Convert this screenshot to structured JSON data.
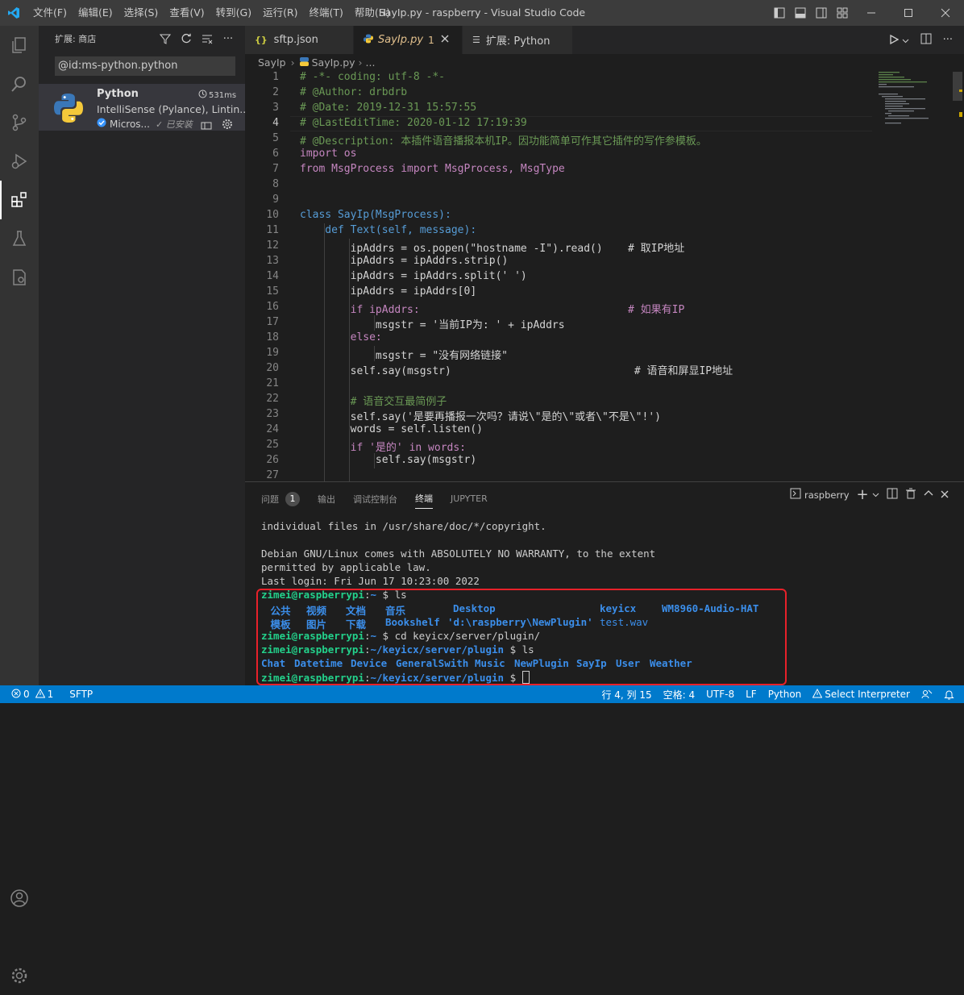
{
  "titlebar": {
    "menu": [
      "文件(F)",
      "编辑(E)",
      "选择(S)",
      "查看(V)",
      "转到(G)",
      "运行(R)",
      "终端(T)",
      "帮助(H)"
    ],
    "title": "SayIp.py - raspberry - Visual Studio Code"
  },
  "sidebar": {
    "title": "扩展: 商店",
    "search_value": "@id:ms-python.python",
    "extension": {
      "name": "Python",
      "timing": "531ms",
      "description": "IntelliSense (Pylance), Lintin...",
      "publisher": "Micros...",
      "status": "✓ 已安装"
    }
  },
  "tabs": [
    {
      "label": "sftp.json",
      "icon": "braces-icon"
    },
    {
      "label": "SayIp.py",
      "badge": "1",
      "icon": "python-file-icon"
    },
    {
      "label": "扩展: Python",
      "icon": "extension-icon"
    }
  ],
  "breadcrumb": {
    "folder": "SayIp",
    "file": "SayIp.py",
    "more": "..."
  },
  "editor": {
    "line_numbers": [
      "1",
      "2",
      "3",
      "4",
      "5",
      "6",
      "7",
      "8",
      "9",
      "10",
      "11",
      "12",
      "13",
      "14",
      "15",
      "16",
      "17",
      "18",
      "19",
      "20",
      "21",
      "22",
      "23",
      "24",
      "25",
      "26",
      "27"
    ],
    "lines": [
      "# -*- coding: utf-8 -*-",
      "# @Author: drbdrb",
      "# @Date: 2019-12-31 15:57:55",
      "# @LastEditTime: 2020-01-12 17:19:39",
      "# @Description: 本插件语音播报本机IP。因功能简单可作其它插件的写作参模板。",
      "import os",
      "from MsgProcess import MsgProcess, MsgType",
      "",
      "",
      "class SayIp(MsgProcess):",
      "    def Text(self, message):",
      "        ipAddrs = os.popen(\"hostname -I\").read()    # 取IP地址",
      "        ipAddrs = ipAddrs.strip()",
      "        ipAddrs = ipAddrs.split(' ')",
      "        ipAddrs = ipAddrs[0]",
      "        if ipAddrs:                                 # 如果有IP",
      "            msgstr = '当前IP为: ' + ipAddrs",
      "        else:",
      "            msgstr = \"没有网络链接\"",
      "        self.say(msgstr)                             # 语音和屏显IP地址",
      "",
      "        # 语音交互最简例子",
      "        self.say('是要再播报一次吗？请说\\\"是的\\\"或者\\\"不是\\\"!')",
      "        words = self.listen()",
      "        if '是的' in words:",
      "            self.say(msgstr)",
      ""
    ]
  },
  "panel": {
    "tabs": [
      "问题",
      "输出",
      "调试控制台",
      "终端",
      "JUPYTER"
    ],
    "problems_count": "1",
    "terminal_name": "raspberry",
    "terminal_lines": [
      "individual files in /usr/share/doc/*/copyright.",
      "",
      "Debian GNU/Linux comes with ABSOLUTELY NO WARRANTY, to the extent",
      "permitted by applicable law.",
      "Last login: Fri Jun 17 10:23:00 2022"
    ],
    "prompt_user": "zimei@raspberrypi",
    "cmd1": "ls",
    "ls1_row1": [
      " 公共",
      "视频",
      "文档",
      "音乐",
      "Desktop",
      "keyicx",
      "WM8960-Audio-HAT"
    ],
    "ls1_row2": [
      " 模板",
      "图片",
      "下载",
      "Bookshelf",
      "'d:\\raspberry\\NewPlugin'",
      "test.wav"
    ],
    "cmd2": "cd keyicx/server/plugin/",
    "path3": "~/keyicx/server/plugin",
    "cmd3": "ls",
    "ls2": [
      "Chat",
      "Datetime",
      "Device",
      "GeneralSwith",
      "Music",
      "NewPlugin",
      "SayIp",
      "User",
      "Weather"
    ]
  },
  "statusbar": {
    "errors": "0",
    "warnings": "1",
    "sftp": "SFTP",
    "position": "行 4, 列 15",
    "spaces": "空格: 4",
    "encoding": "UTF-8",
    "eol": "LF",
    "language": "Python",
    "interpreter": "Select Interpreter"
  }
}
